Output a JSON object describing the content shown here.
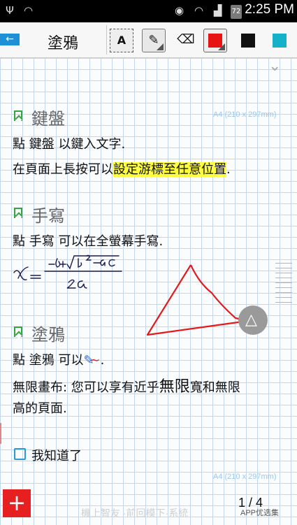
{
  "status_bar": {
    "time": "2:25 PM",
    "battery": "72"
  },
  "toolbar": {
    "title": "塗鴉",
    "text_tool": "A",
    "colors": {
      "red": "#e81313",
      "black": "#111111",
      "cyan": "#14b1c9"
    }
  },
  "page": {
    "page_size_label": "A4 (210 x 297mm)",
    "sections": [
      {
        "heading": "鍵盤",
        "lines": [
          "點 鍵盤 以鍵入文字.",
          "在頁面上長按可以",
          "設定游標至任意位置",
          "."
        ]
      },
      {
        "heading": "手寫",
        "lines": [
          "點 手寫 可以在全螢幕手寫."
        ]
      },
      {
        "heading": "塗鴉",
        "lines": [
          "點 塗鴉 可以",
          ".",
          "無限畫布: 您可以享有近乎",
          "無限",
          "寬和無限",
          "高的頁面."
        ]
      }
    ],
    "checkbox_label": "我知道了",
    "page_indicator": "1 / 4"
  },
  "icons": [
    "usb-icon",
    "wifi-icon",
    "eye-icon",
    "signal-icon",
    "back-arrow-icon",
    "pen-icon",
    "eraser-icon",
    "bookmark-icon",
    "chevron-down-icon",
    "draw-mode-icon",
    "plus-icon"
  ],
  "watermark": {
    "left": "機上智友 ·前回模下·系統",
    "right": "APP优选集"
  }
}
